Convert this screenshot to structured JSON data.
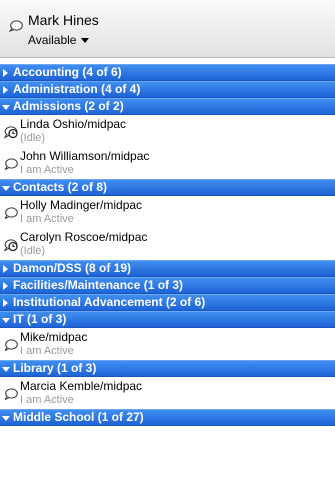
{
  "user": {
    "name": "Mark Hines",
    "status": "Available"
  },
  "groups": [
    {
      "label": "Accounting (4 of 6)",
      "expanded": false,
      "contacts": []
    },
    {
      "label": "Administration (4 of 4)",
      "expanded": false,
      "contacts": []
    },
    {
      "label": "Admissions (2 of 2)",
      "expanded": true,
      "contacts": [
        {
          "name": "Linda Oshio/midpac",
          "status": "(Idle)",
          "icon": "idle-clock-icon"
        },
        {
          "name": "John Williamson/midpac",
          "status": "I am Active",
          "icon": "chat-bubble-icon"
        }
      ]
    },
    {
      "label": "Contacts (2 of 8)",
      "expanded": true,
      "contacts": [
        {
          "name": "Holly Madinger/midpac",
          "status": "I am Active",
          "icon": "chat-bubble-icon"
        },
        {
          "name": "Carolyn Roscoe/midpac",
          "status": "(Idle)",
          "icon": "idle-clock-icon"
        }
      ]
    },
    {
      "label": "Damon/DSS (8 of 19)",
      "expanded": false,
      "contacts": []
    },
    {
      "label": "Facilities/Maintenance (1 of 3)",
      "expanded": false,
      "contacts": []
    },
    {
      "label": "Institutional Advancement (2 of 6)",
      "expanded": false,
      "contacts": []
    },
    {
      "label": "IT (1 of 3)",
      "expanded": true,
      "contacts": [
        {
          "name": "Mike/midpac",
          "status": "I am Active",
          "icon": "chat-bubble-icon"
        }
      ]
    },
    {
      "label": "Library (1 of 3)",
      "expanded": true,
      "contacts": [
        {
          "name": "Marcia Kemble/midpac",
          "status": "I am Active",
          "icon": "chat-bubble-icon"
        }
      ]
    },
    {
      "label": "Middle School (1 of 27)",
      "expanded": true,
      "contacts": []
    }
  ]
}
